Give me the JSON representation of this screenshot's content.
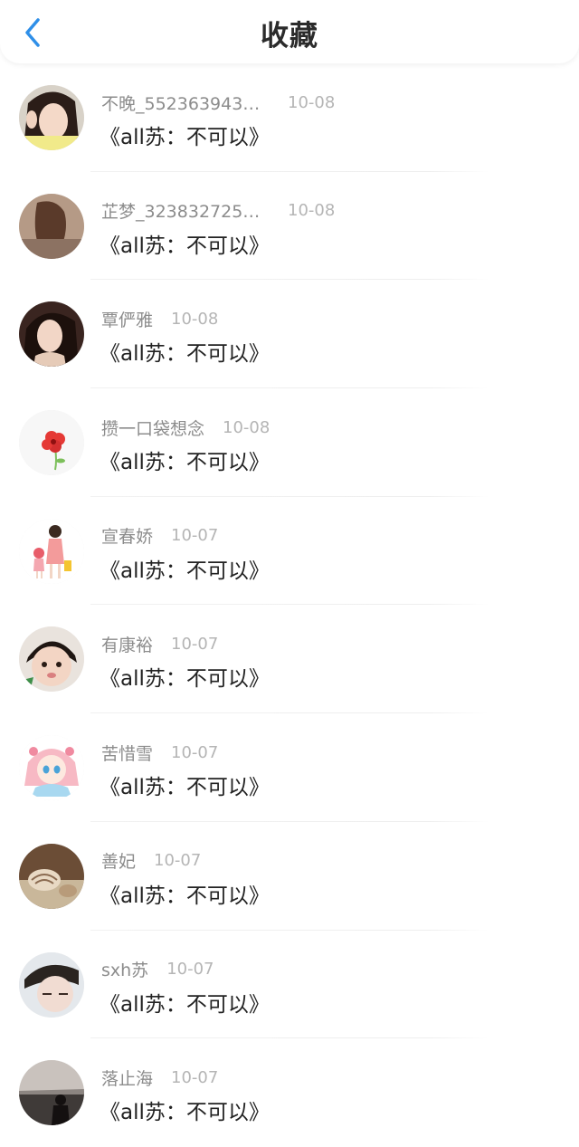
{
  "header": {
    "title": "收藏",
    "back_icon": "chevron-left-icon",
    "back_color": "#2f8fe8"
  },
  "items": [
    {
      "name": "不晚_5523639438...",
      "time": "10-08",
      "content": "《all苏：不可以》",
      "avatar": "avatar-photo-girl-peace-sign"
    },
    {
      "name": "芷梦_3238327253...",
      "time": "10-08",
      "content": "《all苏：不可以》",
      "avatar": "avatar-photo-hair"
    },
    {
      "name": "覃俨雅",
      "time": "10-08",
      "content": "《all苏：不可以》",
      "avatar": "avatar-photo-woman"
    },
    {
      "name": "攒一口袋想念",
      "time": "10-08",
      "content": "《all苏：不可以》",
      "avatar": "avatar-red-flower"
    },
    {
      "name": "宣春娇",
      "time": "10-07",
      "content": "《all苏：不可以》",
      "avatar": "avatar-cartoon-girls"
    },
    {
      "name": "有康裕",
      "time": "10-07",
      "content": "《all苏：不可以》",
      "avatar": "avatar-photo-toddler"
    },
    {
      "name": "苦惜雪",
      "time": "10-07",
      "content": "《all苏：不可以》",
      "avatar": "avatar-anime-girl"
    },
    {
      "name": "善妃",
      "time": "10-07",
      "content": "《all苏：不可以》",
      "avatar": "avatar-seashell"
    },
    {
      "name": "sxh苏",
      "time": "10-07",
      "content": "《all苏：不可以》",
      "avatar": "avatar-photo-boy"
    },
    {
      "name": "落止海",
      "time": "10-07",
      "content": "《all苏：不可以》",
      "avatar": "avatar-photo-seaside"
    }
  ]
}
